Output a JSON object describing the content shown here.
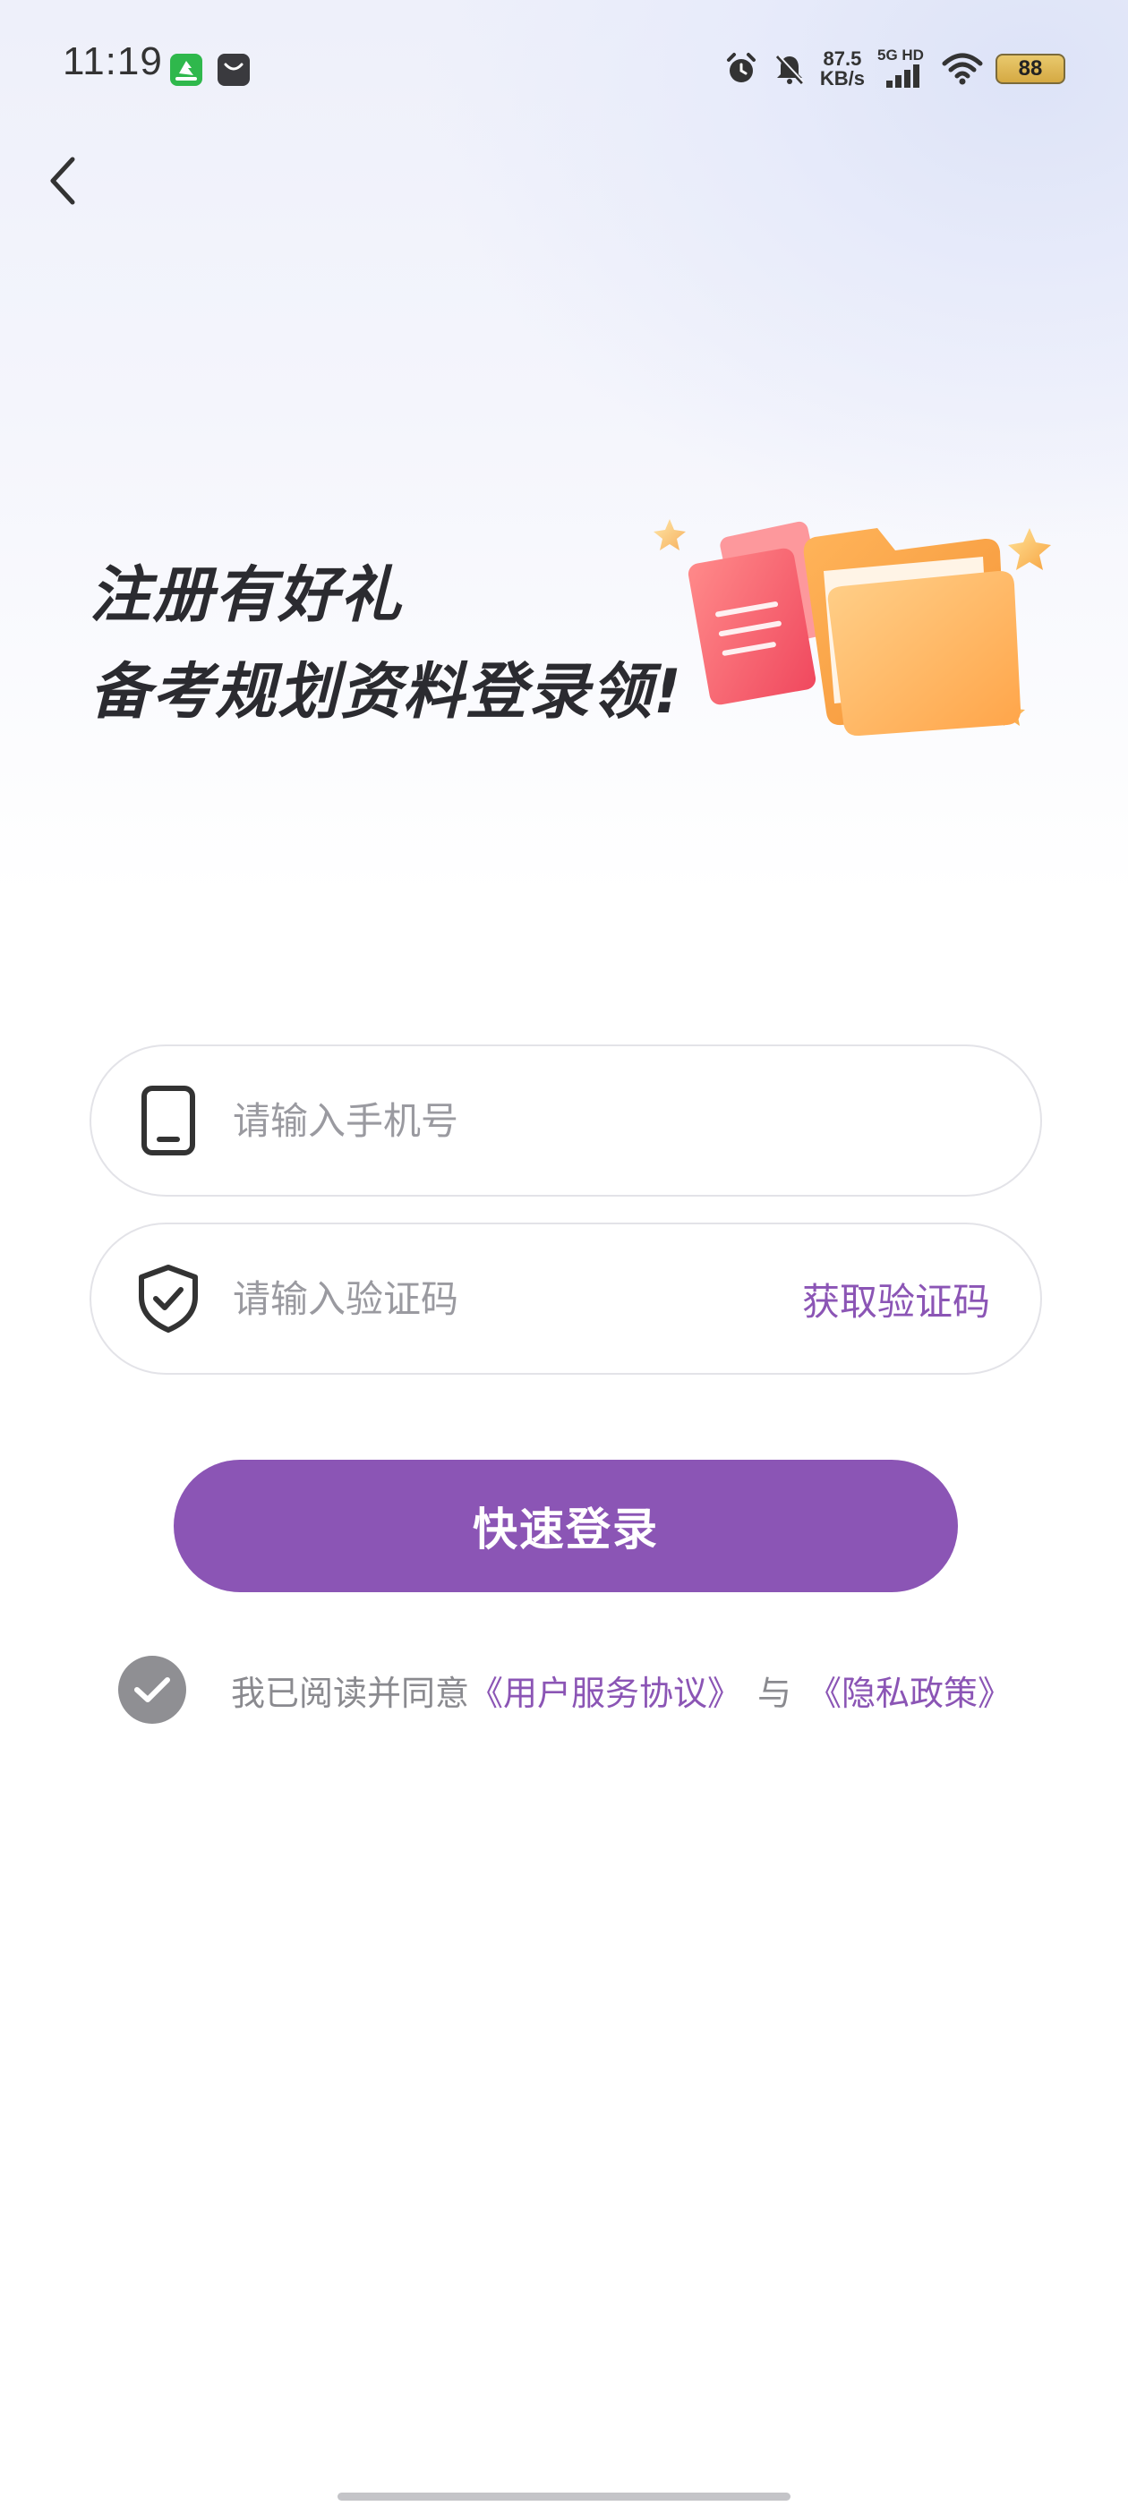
{
  "status_bar": {
    "time": "11:19",
    "net_speed_value": "87.5",
    "net_speed_unit": "KB/s",
    "signal_label": "5G HD",
    "battery": "88"
  },
  "promo": {
    "line1": "注册有好礼",
    "line2": "备考规划资料登录领!"
  },
  "phone_input": {
    "placeholder": "请输入手机号",
    "value": ""
  },
  "code_input": {
    "placeholder": "请输入验证码",
    "value": "",
    "get_code_label": "获取验证码"
  },
  "login_button_label": "快速登录",
  "agreement": {
    "checked": true,
    "prefix": "我已阅读并同意",
    "link_terms": "《用户服务协议》",
    "conjunction": "与",
    "link_privacy": "《隐私政策》"
  },
  "colors": {
    "accent": "#8b55b5",
    "muted_text": "#8a8a8f",
    "title_text": "#2b2b30"
  }
}
